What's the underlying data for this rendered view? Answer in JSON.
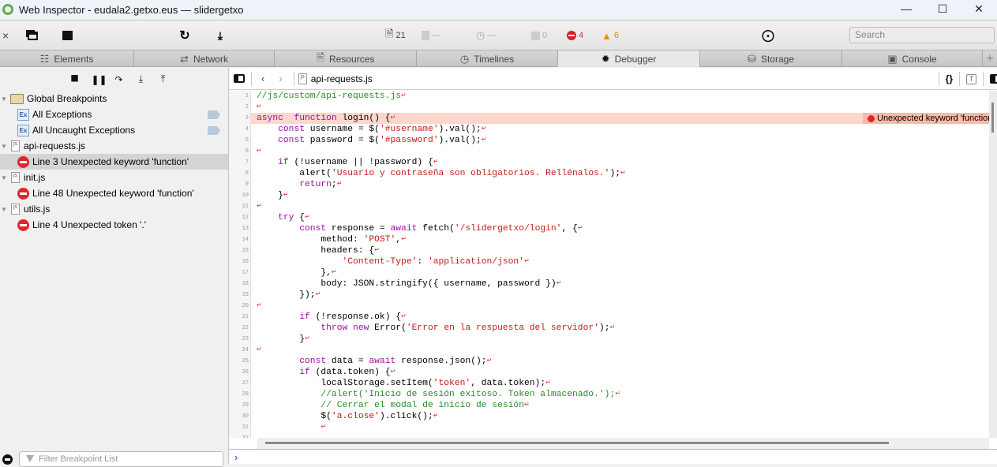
{
  "window": {
    "title": "Web Inspector - eudala2.getxo.eus — slidergetxo",
    "controls": [
      "minimize",
      "maximize",
      "close"
    ]
  },
  "toolbar": {
    "stats": {
      "resources": "21",
      "size": "—",
      "time": "—",
      "logs": "0",
      "errors": "4",
      "warnings": "6"
    },
    "search_placeholder": "Search"
  },
  "tabs": [
    {
      "label": "Elements",
      "icon": "elements-icon"
    },
    {
      "label": "Network",
      "icon": "network-icon"
    },
    {
      "label": "Resources",
      "icon": "resources-icon"
    },
    {
      "label": "Timelines",
      "icon": "timelines-icon"
    },
    {
      "label": "Debugger",
      "icon": "debugger-icon",
      "active": true
    },
    {
      "label": "Storage",
      "icon": "storage-icon"
    },
    {
      "label": "Console",
      "icon": "console-icon"
    }
  ],
  "sidebar": {
    "global_breakpoints": "Global Breakpoints",
    "all_exceptions": "All Exceptions",
    "all_uncaught": "All Uncaught Exceptions",
    "files": [
      {
        "name": "api-requests.js",
        "issue": "Line 3 Unexpected keyword 'function'"
      },
      {
        "name": "init.js",
        "issue": "Line 48 Unexpected keyword 'function'"
      },
      {
        "name": "utils.js",
        "issue": "Line 4 Unexpected token '.'"
      }
    ],
    "filter_placeholder": "Filter Breakpoint List"
  },
  "editor": {
    "filename": "api-requests.js",
    "error_message": "Unexpected keyword 'function'",
    "error_line": 3,
    "lines": [
      [
        [
          "cm",
          "//js/custom/api-requests.js"
        ]
      ],
      [],
      [
        [
          "kw",
          "async"
        ],
        [
          "",
          "  "
        ],
        [
          "kw",
          "function"
        ],
        [
          "",
          " login() {"
        ]
      ],
      [
        [
          "",
          "    "
        ],
        [
          "kw",
          "const"
        ],
        [
          "",
          " username = $("
        ],
        [
          "st",
          "'#username'"
        ],
        [
          "",
          ").val();"
        ]
      ],
      [
        [
          "",
          "    "
        ],
        [
          "kw",
          "const"
        ],
        [
          "",
          " password = $("
        ],
        [
          "st",
          "'#password'"
        ],
        [
          "",
          ").val();"
        ]
      ],
      [],
      [
        [
          "",
          "    "
        ],
        [
          "kw",
          "if"
        ],
        [
          "",
          " (!username || !password) {"
        ]
      ],
      [
        [
          "",
          "        alert("
        ],
        [
          "st",
          "'Usuario y contraseña son obligatorios. Rellénalos.'"
        ],
        [
          "",
          ");"
        ]
      ],
      [
        [
          "",
          "        "
        ],
        [
          "kw",
          "return"
        ],
        [
          "",
          ";"
        ]
      ],
      [
        [
          "",
          "    }"
        ]
      ],
      [],
      [
        [
          "",
          "    "
        ],
        [
          "kw",
          "try"
        ],
        [
          "",
          " {"
        ]
      ],
      [
        [
          "",
          "        "
        ],
        [
          "kw",
          "const"
        ],
        [
          "",
          " response = "
        ],
        [
          "kw",
          "await"
        ],
        [
          "",
          " fetch("
        ],
        [
          "st",
          "'/slidergetxo/login'"
        ],
        [
          "",
          ", {"
        ]
      ],
      [
        [
          "",
          "            method: "
        ],
        [
          "st",
          "'POST'"
        ],
        [
          "",
          ","
        ]
      ],
      [
        [
          "",
          "            headers: {"
        ]
      ],
      [
        [
          "",
          "                "
        ],
        [
          "st",
          "'Content-Type'"
        ],
        [
          "",
          ": "
        ],
        [
          "st",
          "'application/json'"
        ]
      ],
      [
        [
          "",
          "            },"
        ]
      ],
      [
        [
          "",
          "            body: JSON.stringify({ username, password })"
        ]
      ],
      [
        [
          "",
          "        });"
        ]
      ],
      [],
      [
        [
          "",
          "        "
        ],
        [
          "kw",
          "if"
        ],
        [
          "",
          " (!response.ok) {"
        ]
      ],
      [
        [
          "",
          "            "
        ],
        [
          "kw",
          "throw"
        ],
        [
          "",
          " "
        ],
        [
          "kw",
          "new"
        ],
        [
          "",
          " Error("
        ],
        [
          "st",
          "'Error en la respuesta del servidor'"
        ],
        [
          "",
          ");"
        ]
      ],
      [
        [
          "",
          "        }"
        ]
      ],
      [],
      [
        [
          "",
          "        "
        ],
        [
          "kw",
          "const"
        ],
        [
          "",
          " data = "
        ],
        [
          "kw",
          "await"
        ],
        [
          "",
          " response.json();"
        ]
      ],
      [
        [
          "",
          "        "
        ],
        [
          "kw",
          "if"
        ],
        [
          "",
          " (data.token) {"
        ]
      ],
      [
        [
          "",
          "            localStorage.setItem("
        ],
        [
          "st",
          "'token'"
        ],
        [
          "",
          ", data.token);"
        ]
      ],
      [
        [
          "",
          "            "
        ],
        [
          "cm",
          "//alert('Inicio de sesión exitoso. Token almacenado.');"
        ]
      ],
      [
        [
          "",
          "            "
        ],
        [
          "cm",
          "// Cerrar el modal de inicio de sesión"
        ]
      ],
      [
        [
          "",
          "            $("
        ],
        [
          "st",
          "'a.close'"
        ],
        [
          "",
          ").click();"
        ]
      ],
      [
        [
          "",
          "            "
        ]
      ],
      null
    ]
  }
}
